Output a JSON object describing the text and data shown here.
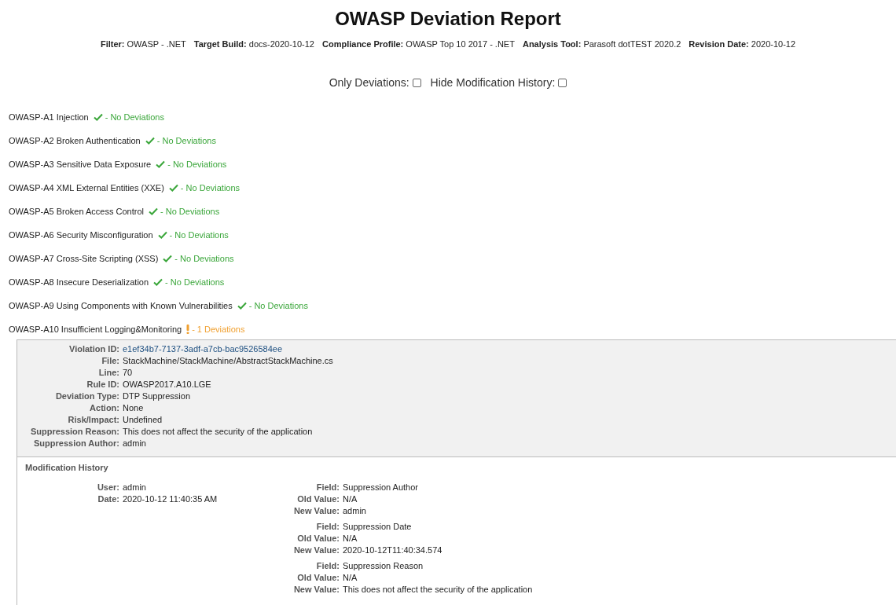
{
  "title": "OWASP Deviation Report",
  "meta": [
    {
      "label": "Filter:",
      "value": "OWASP - .NET"
    },
    {
      "label": "Target Build:",
      "value": "docs-2020-10-12"
    },
    {
      "label": "Compliance Profile:",
      "value": "OWASP Top 10 2017 - .NET"
    },
    {
      "label": "Analysis Tool:",
      "value": "Parasoft dotTEST 2020.2"
    },
    {
      "label": "Revision Date:",
      "value": "2020-10-12"
    }
  ],
  "options": [
    {
      "label": "Only Deviations:",
      "checked": false
    },
    {
      "label": "Hide Modification History:",
      "checked": false
    }
  ],
  "categories": [
    {
      "name": "OWASP-A1 Injection",
      "kind": "ok",
      "status": "- No Deviations"
    },
    {
      "name": "OWASP-A2 Broken Authentication",
      "kind": "ok",
      "status": "- No Deviations"
    },
    {
      "name": "OWASP-A3 Sensitive Data Exposure",
      "kind": "ok",
      "status": "- No Deviations"
    },
    {
      "name": "OWASP-A4 XML External Entities (XXE)",
      "kind": "ok",
      "status": "- No Deviations"
    },
    {
      "name": "OWASP-A5 Broken Access Control",
      "kind": "ok",
      "status": "- No Deviations"
    },
    {
      "name": "OWASP-A6 Security Misconfiguration",
      "kind": "ok",
      "status": "- No Deviations"
    },
    {
      "name": "OWASP-A7 Cross-Site Scripting (XSS)",
      "kind": "ok",
      "status": "- No Deviations"
    },
    {
      "name": "OWASP-A8 Insecure Deserialization",
      "kind": "ok",
      "status": "- No Deviations"
    },
    {
      "name": "OWASP-A9 Using Components with Known Vulnerabilities",
      "kind": "ok",
      "status": "- No Deviations"
    },
    {
      "name": "OWASP-A10 Insufficient Logging&Monitoring",
      "kind": "deviation",
      "status": "- 1 Deviations"
    }
  ],
  "violation": {
    "fields": [
      {
        "label": "Violation ID:",
        "value": "e1ef34b7-7137-3adf-a7cb-bac9526584ee",
        "kind": "link"
      },
      {
        "label": "File:",
        "value": "StackMachine/StackMachine/AbstractStackMachine.cs",
        "kind": "text"
      },
      {
        "label": "Line:",
        "value": "70",
        "kind": "text"
      },
      {
        "label": "Rule ID:",
        "value": "OWASP2017.A10.LGE",
        "kind": "text"
      },
      {
        "label": "Deviation Type:",
        "value": "DTP Suppression",
        "kind": "text"
      },
      {
        "label": "Action:",
        "value": "None",
        "kind": "text"
      },
      {
        "label": "Risk/Impact:",
        "value": "Undefined",
        "kind": "text"
      },
      {
        "label": "Suppression Reason:",
        "value": "This does not affect the security of the application",
        "kind": "text"
      },
      {
        "label": "Suppression Author:",
        "value": "admin",
        "kind": "text"
      }
    ]
  },
  "modification_history": {
    "title": "Modification History",
    "entry": [
      {
        "label": "User:",
        "value": "admin"
      },
      {
        "label": "Date:",
        "value": "2020-10-12 11:40:35 AM"
      }
    ],
    "changes": [
      [
        {
          "label": "Field:",
          "value": "Suppression Author"
        },
        {
          "label": "Old Value:",
          "value": "N/A"
        },
        {
          "label": "New Value:",
          "value": "admin"
        }
      ],
      [
        {
          "label": "Field:",
          "value": "Suppression Date"
        },
        {
          "label": "Old Value:",
          "value": "N/A"
        },
        {
          "label": "New Value:",
          "value": "2020-10-12T11:40:34.574"
        }
      ],
      [
        {
          "label": "Field:",
          "value": "Suppression Reason"
        },
        {
          "label": "Old Value:",
          "value": "N/A"
        },
        {
          "label": "New Value:",
          "value": "This does not affect the security of the application"
        }
      ]
    ]
  }
}
